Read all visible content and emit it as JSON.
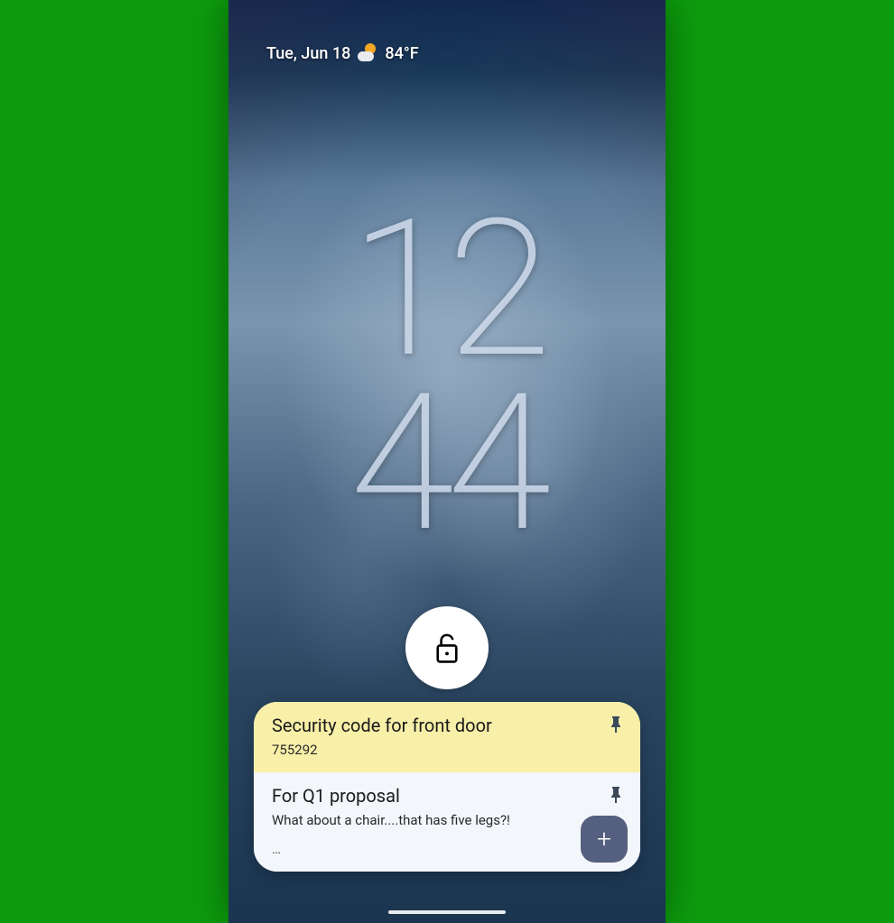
{
  "status": {
    "date": "Tue, Jun 18",
    "temperature": "84°F"
  },
  "clock": {
    "hour": "12",
    "minute": "44"
  },
  "notes": [
    {
      "title": "Security code for front door",
      "body": "755292",
      "pinned": true,
      "color": "yellow"
    },
    {
      "title": "For Q1 proposal",
      "body": "What about a chair....that has five legs?!",
      "more": "…",
      "pinned": true,
      "color": "white"
    }
  ]
}
